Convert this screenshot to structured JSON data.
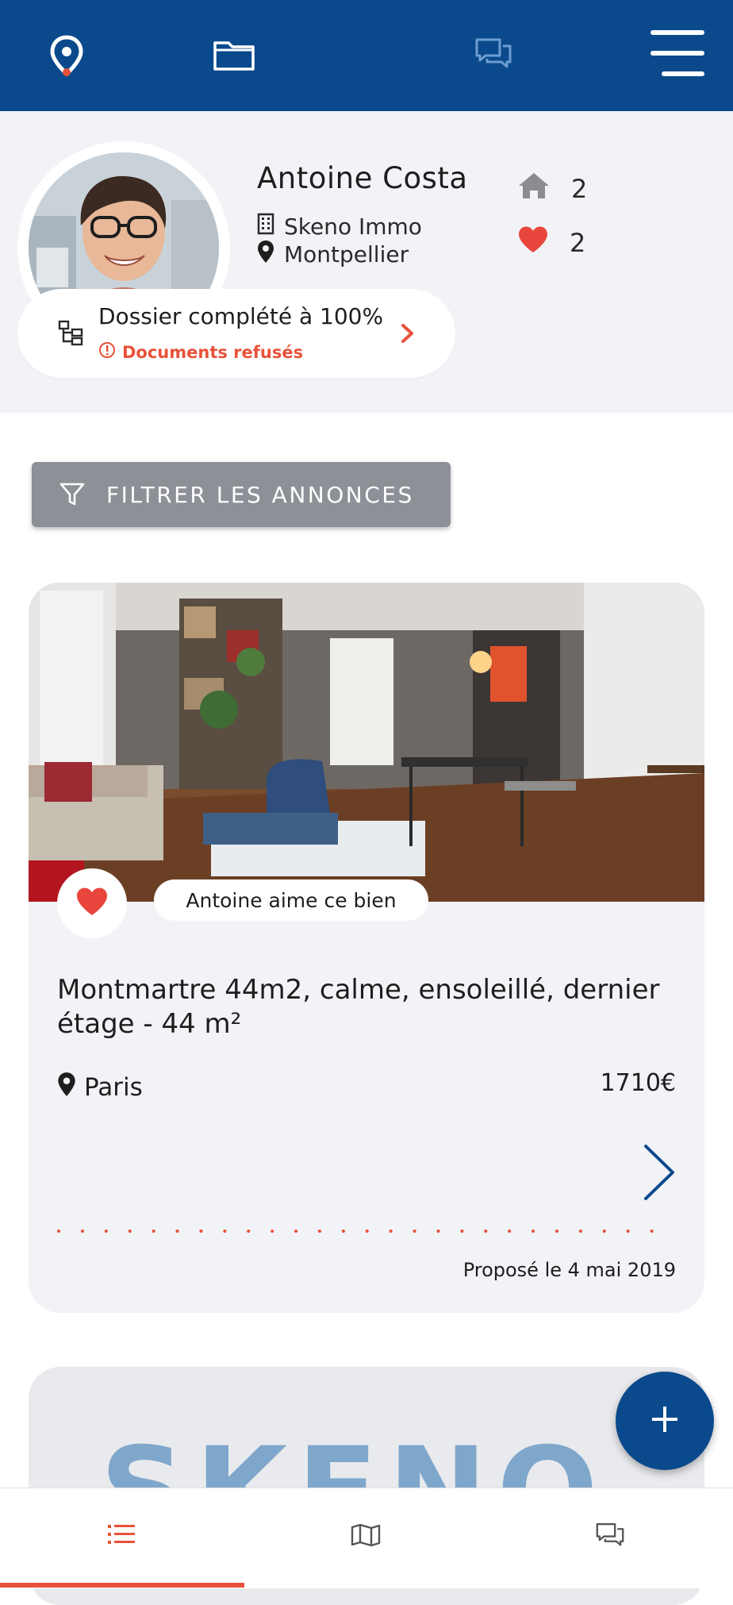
{
  "header": {
    "icons": [
      "location-pin-icon",
      "folder-icon",
      "chat-icon",
      "hamburger-menu-icon"
    ],
    "colors": {
      "bar": "#0a4a8c",
      "accent": "#e8523a"
    }
  },
  "profile": {
    "name": "Antoine Costa",
    "agency": "Skeno Immo",
    "city": "Montpellier",
    "stats": {
      "houses": "2",
      "favorites": "2"
    },
    "dossier": {
      "title": "Dossier complété à 100%",
      "warning": "Documents refusés"
    }
  },
  "filter": {
    "label": "FILTRER LES ANNONCES"
  },
  "listing": {
    "liked_by": "Antoine aime ce bien",
    "title": "Montmartre 44m2, calme, ensoleillé, dernier étage - 44 m²",
    "city": "Paris",
    "price": "1710€",
    "proposed": "Proposé le 4 mai 2019"
  },
  "second_card": {
    "brand_text": "SKENO"
  },
  "bottom_nav": {
    "items": [
      "list-icon",
      "map-icon",
      "chat-icon"
    ],
    "active_index": 0
  }
}
